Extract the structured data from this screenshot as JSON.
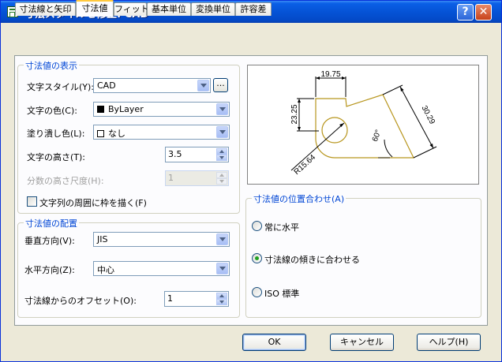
{
  "window": {
    "title": "寸法スタイルを修正: CAD",
    "help_symbol": "?",
    "close_symbol": "✕"
  },
  "tabs": [
    {
      "label": "寸法線と矢印"
    },
    {
      "label": "寸法値",
      "active": true
    },
    {
      "label": "フィット"
    },
    {
      "label": "基本単位"
    },
    {
      "label": "変換単位"
    },
    {
      "label": "許容差"
    }
  ],
  "text_appearance": {
    "title": "寸法値の表示",
    "text_style": {
      "label": "文字スタイル(Y):",
      "value": "CAD",
      "browse": "..."
    },
    "text_color": {
      "label": "文字の色(C):",
      "value": "ByLayer"
    },
    "fill_color": {
      "label": "塗り潰し色(L):",
      "value": "なし"
    },
    "text_height": {
      "label": "文字の高さ(T):",
      "value": "3.5"
    },
    "fraction_scale": {
      "label": "分数の高さ尺度(H):",
      "value": "1"
    },
    "frame_text": {
      "label": "文字列の周囲に枠を描く(F)"
    }
  },
  "text_placement": {
    "title": "寸法値の配置",
    "vertical": {
      "label": "垂直方向(V):",
      "value": "JIS"
    },
    "horizontal": {
      "label": "水平方向(Z):",
      "value": "中心"
    },
    "offset": {
      "label": "寸法線からのオフセット(O):",
      "value": "1"
    }
  },
  "preview": {
    "dim_top": "19.75",
    "dim_left": "23.25",
    "dim_right": "30.29",
    "dim_angle": "60°",
    "dim_radius": "R15.64"
  },
  "text_alignment": {
    "title": "寸法値の位置合わせ(A)",
    "options": [
      {
        "label": "常に水平",
        "checked": false
      },
      {
        "label": "寸法線の傾きに合わせる",
        "checked": true
      },
      {
        "label": "ISO 標準",
        "checked": false
      }
    ]
  },
  "buttons": {
    "ok": "OK",
    "cancel": "キャンセル",
    "help": "ヘルプ(H)"
  },
  "colors": {
    "title_bar": "#0553D6",
    "group_title": "#0046D5",
    "preview_geometry": "#B8961E"
  }
}
